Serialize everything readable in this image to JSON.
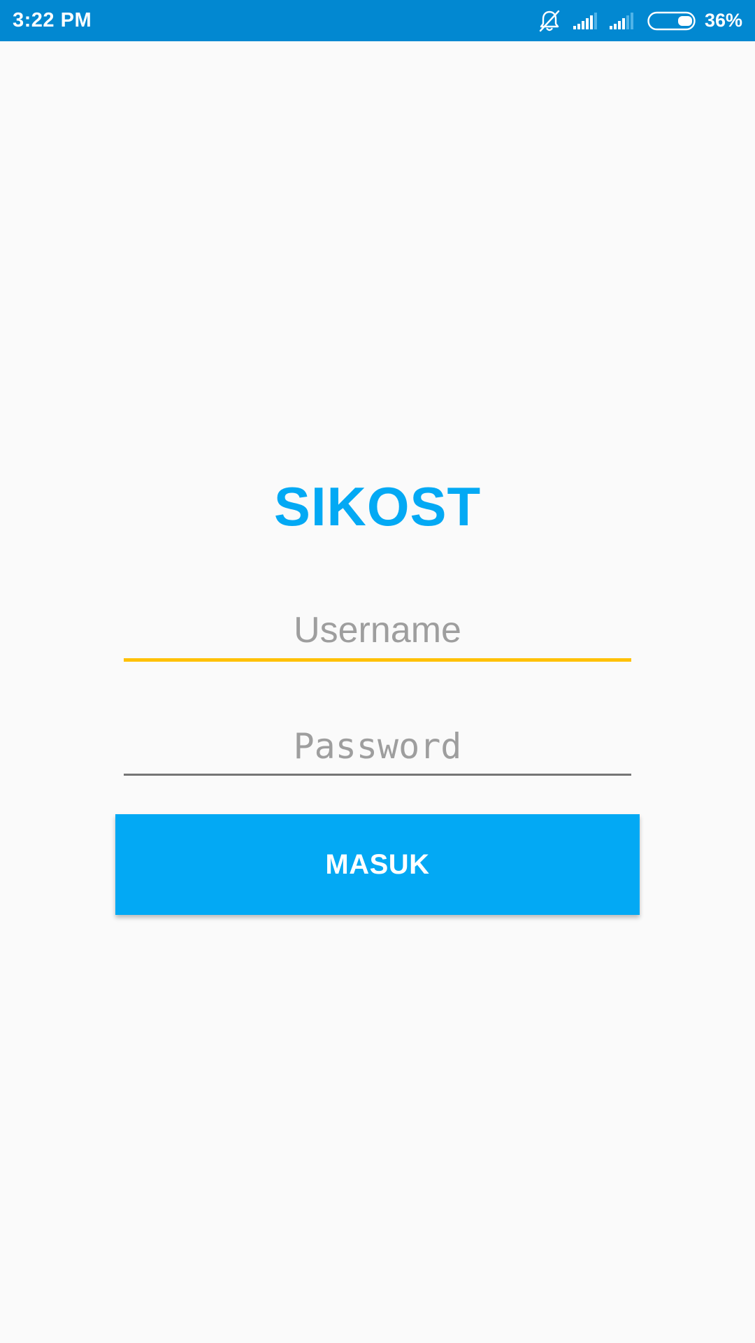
{
  "status_bar": {
    "time": "3:22 PM",
    "battery_percent": "36%",
    "battery_level": 0.36,
    "icons": [
      "bell-off-icon",
      "signal-icon",
      "signal-icon",
      "battery-icon"
    ],
    "background_color": "#0288D1"
  },
  "app": {
    "title": "SIKOST",
    "accent_color": "#03A9F4"
  },
  "login_form": {
    "username": {
      "placeholder": "Username",
      "value": "",
      "underline_color": "#FFC107",
      "focused": true
    },
    "password": {
      "placeholder": "Password",
      "value": "",
      "underline_color": "#757575"
    },
    "submit_label": "MASUK",
    "submit_color": "#03A9F4"
  }
}
